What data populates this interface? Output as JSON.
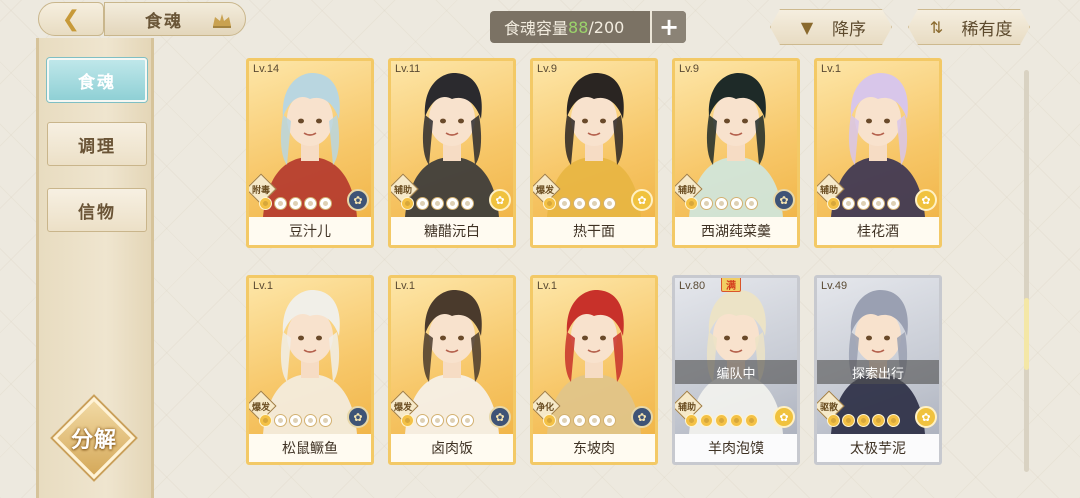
{
  "header": {
    "back_icon": "back-arrow-icon",
    "title": "食魂",
    "capacity_label": "食魂容量",
    "capacity_current": "88",
    "capacity_sep_max": "/200",
    "add_label": "+",
    "sort_desc_label": "降序",
    "sort_rarity_label": "稀有度"
  },
  "sidebar": {
    "items": [
      {
        "label": "食魂",
        "active": true
      },
      {
        "label": "调理",
        "active": false
      },
      {
        "label": "信物",
        "active": false
      }
    ],
    "decompose_label": "分解"
  },
  "colors": {
    "card_gold": "#f3c966",
    "card_silver": "#c7c9cf",
    "active_tab": "#8fd0d5",
    "capacity_current": "#9bd36b"
  },
  "cards": [
    {
      "level": "Lv.14",
      "role": "附毒",
      "name": "豆汁儿",
      "stars_on": 1,
      "element": "dark",
      "status": "",
      "max": "",
      "frame": "gold",
      "hair": "#b9d6e0",
      "cloth": "#b43a2e"
    },
    {
      "level": "Lv.11",
      "role": "辅助",
      "name": "糖醋沅白",
      "stars_on": 1,
      "element": "gold",
      "status": "",
      "max": "",
      "frame": "gold",
      "hair": "#2b2a2e",
      "cloth": "#3a3a3a"
    },
    {
      "level": "Lv.9",
      "role": "爆发",
      "name": "热干面",
      "stars_on": 1,
      "element": "gold",
      "status": "",
      "max": "",
      "frame": "gold",
      "hair": "#2a2522",
      "cloth": "#e7b542"
    },
    {
      "level": "Lv.9",
      "role": "辅助",
      "name": "西湖莼菜羹",
      "stars_on": 1,
      "element": "dark",
      "status": "",
      "max": "",
      "frame": "gold",
      "hair": "#1e2a28",
      "cloth": "#cfe6dd"
    },
    {
      "level": "Lv.1",
      "role": "辅助",
      "name": "桂花酒",
      "stars_on": 1,
      "element": "gold",
      "status": "",
      "max": "",
      "frame": "gold",
      "hair": "#d8c6ea",
      "cloth": "#3c3552"
    },
    {
      "level": "Lv.1",
      "role": "爆发",
      "name": "松鼠鳜鱼",
      "stars_on": 1,
      "element": "dark",
      "status": "",
      "max": "",
      "frame": "gold",
      "hair": "#f1efe8",
      "cloth": "#f3ede0"
    },
    {
      "level": "Lv.1",
      "role": "爆发",
      "name": "卤肉饭",
      "stars_on": 1,
      "element": "dark",
      "status": "",
      "max": "",
      "frame": "gold",
      "hair": "#4a3a2c",
      "cloth": "#f5f1ea"
    },
    {
      "level": "Lv.1",
      "role": "净化",
      "name": "东坡肉",
      "stars_on": 1,
      "element": "dark",
      "status": "",
      "max": "",
      "frame": "gold",
      "hair": "#c8312a",
      "cloth": "#e0c48a"
    },
    {
      "level": "Lv.80",
      "role": "辅助",
      "name": "羊肉泡馍",
      "stars_on": 5,
      "element": "gold",
      "status": "编队中",
      "max": "满",
      "frame": "silver",
      "hair": "#ece3c6",
      "cloth": "#f2f2ee"
    },
    {
      "level": "Lv.49",
      "role": "驱散",
      "name": "太极芋泥",
      "stars_on": 5,
      "element": "gold",
      "status": "探索出行",
      "max": "",
      "frame": "silver",
      "hair": "#9aa0b2",
      "cloth": "#2d2f45"
    }
  ]
}
